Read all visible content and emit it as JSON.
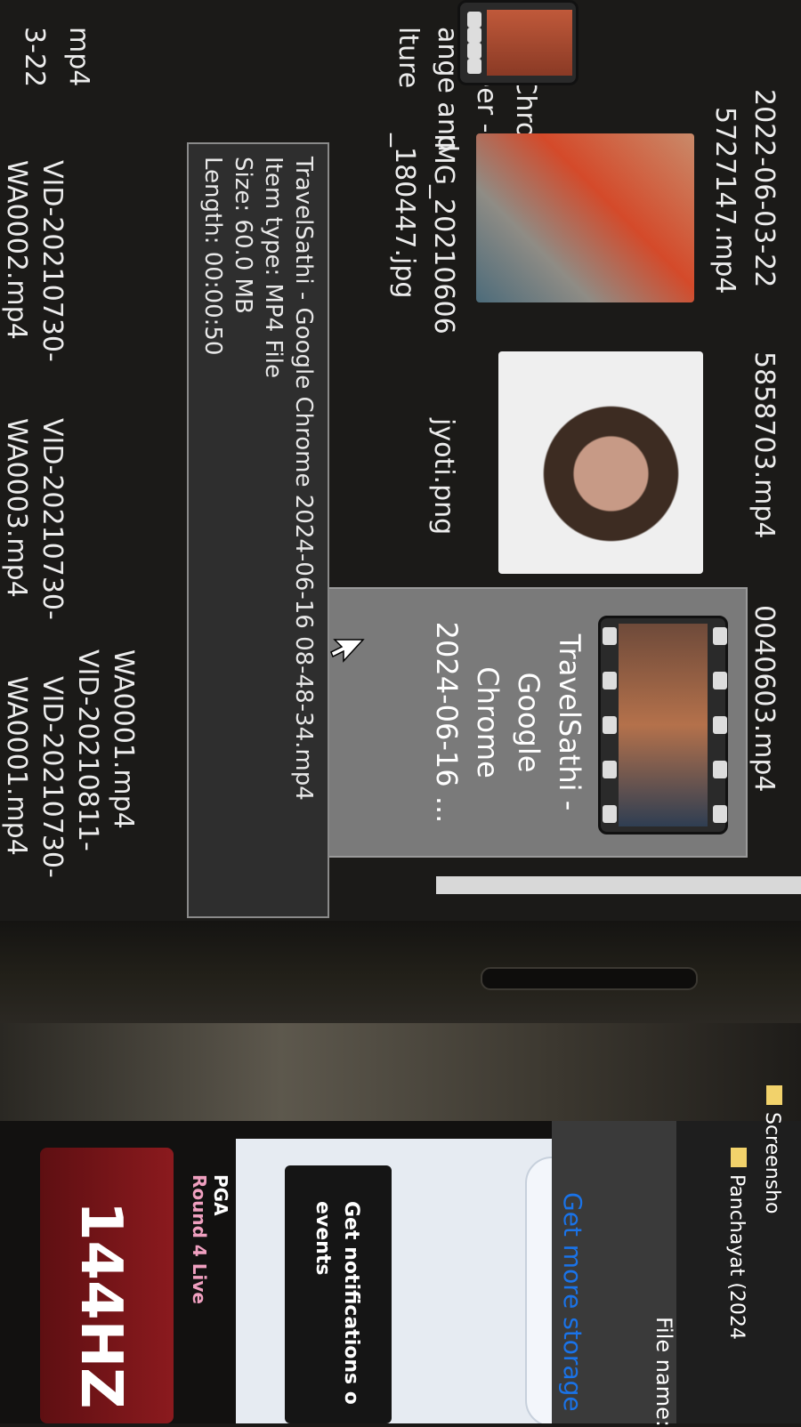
{
  "file_grid": {
    "top_partial_labels": [
      "3-22",
      "mp4",
      "lture",
      "ange and",
      "unteer -",
      "gle Chro..."
    ],
    "col_1": [
      "2022-06-03-22",
      "5727147.mp4"
    ],
    "col_2": [
      "5858703.mp4"
    ],
    "col_3": [
      "0040603.mp4"
    ],
    "img_file": [
      "IMG_20210606",
      "_180447.jpg"
    ],
    "png_file": "jyoti.png",
    "selected_item": {
      "name_lines": [
        "TravelSathi -",
        "Google",
        "Chrome",
        "2024-06-16 ..."
      ]
    },
    "bottom_rows": [
      [
        "VID-20210730-",
        "VID-20210730-",
        "VID-20210730-",
        "VID-20210811-"
      ],
      [
        "WA0001.mp4",
        "WA0002.mp4",
        "WA0003.mp4",
        "WA0001.mp4"
      ]
    ]
  },
  "tooltip": {
    "line1": "TravelSathi - Google Chrome 2024-06-16 08-48-34.mp4",
    "line2": "Item type: MP4 File",
    "line3": "Size: 60.0 MB",
    "line4": "Length: 00:00:50"
  },
  "lower_screen": {
    "folders": [
      "Screensho",
      "Panchayat (2024"
    ],
    "file_name_label": "File name:",
    "storage_link": "Get more storage",
    "notification_text": [
      "Get notifications o",
      "events"
    ],
    "sidebar_item": [
      "PGA",
      "Round 4 Live"
    ],
    "monitor_badge": "144HZ"
  },
  "colors": {
    "selected_bg": "#7a7a7a",
    "tooltip_bg": "#2e2e2e",
    "storage_link": "#1a73e8",
    "badge_red": "#8b1a1e"
  }
}
